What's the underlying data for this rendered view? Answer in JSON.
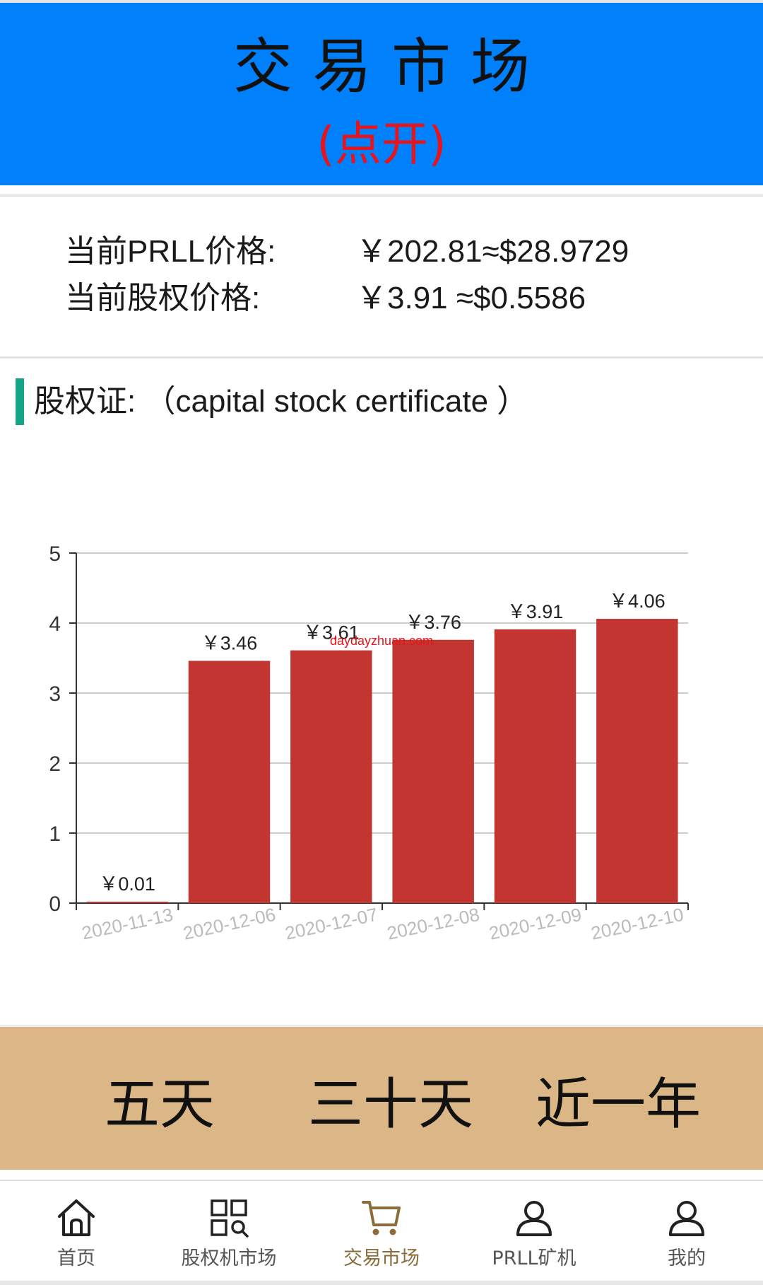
{
  "header": {
    "title": "交易市场",
    "expand_link": "(点开)"
  },
  "prices": [
    {
      "label": "当前PRLL价格:",
      "value": "￥202.81≈$28.9729"
    },
    {
      "label": "当前股权价格:",
      "value": "￥3.91 ≈$0.5586"
    }
  ],
  "section": {
    "title": "股权证: （capital stock certificate ）"
  },
  "watermark": "daydayzhuan.com",
  "colors": {
    "header_bg": "#0080fb",
    "expand_link": "#e8141b",
    "section_accent": "#17a58a",
    "bar": "#c23531",
    "range_panel_bg": "#dbb686",
    "nav_active": "#8a6d3b"
  },
  "chart_data": {
    "type": "bar",
    "categories": [
      "2020-11-13",
      "2020-12-06",
      "2020-12-07",
      "2020-12-08",
      "2020-12-09",
      "2020-12-10"
    ],
    "values": [
      0.01,
      3.46,
      3.61,
      3.76,
      3.91,
      4.06
    ],
    "data_labels": [
      "￥0.01",
      "￥3.46",
      "￥3.61",
      "￥3.76",
      "￥3.91",
      "￥4.06"
    ],
    "ylim": [
      0,
      5
    ],
    "yticks": [
      0,
      1,
      2,
      3,
      4,
      5
    ],
    "grid": true,
    "title": "",
    "xlabel": "",
    "ylabel": ""
  },
  "range_buttons": [
    {
      "label": "五天"
    },
    {
      "label": "三十天"
    },
    {
      "label": "近一年"
    }
  ],
  "nav": [
    {
      "label": "首页",
      "icon": "home-icon"
    },
    {
      "label": "股权机市场",
      "icon": "grid-search-icon"
    },
    {
      "label": "交易市场",
      "icon": "cart-icon",
      "active": true
    },
    {
      "label": "PRLL矿机",
      "icon": "user-icon"
    },
    {
      "label": "我的",
      "icon": "user-icon"
    }
  ]
}
